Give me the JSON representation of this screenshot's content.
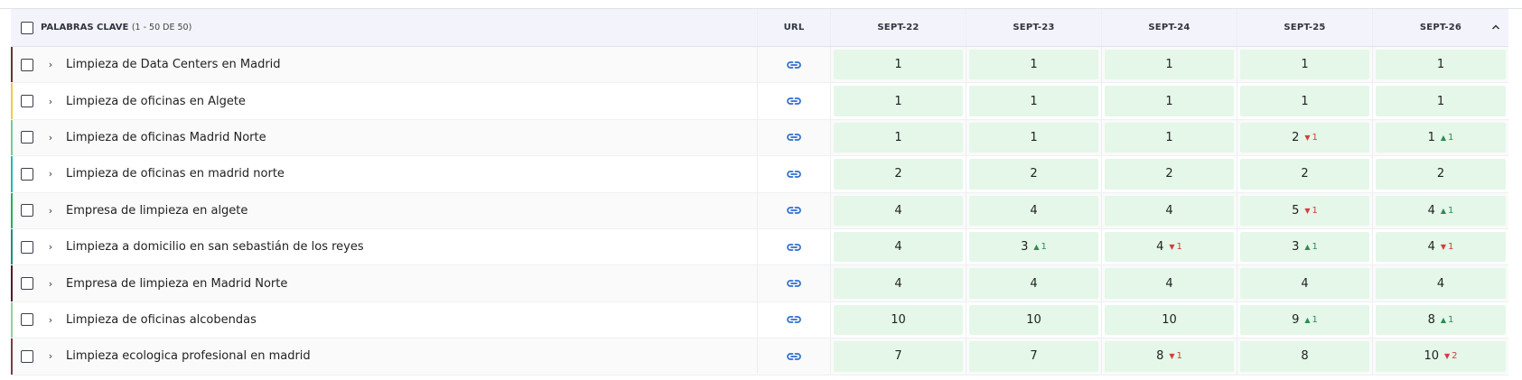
{
  "header": {
    "keywords_label": "PALABRAS CLAVE",
    "keywords_count": "(1 - 50 DE 50)",
    "url_label": "URL",
    "dates": [
      "SEPT-22",
      "SEPT-23",
      "SEPT-24",
      "SEPT-25",
      "SEPT-26"
    ]
  },
  "colors": {
    "cell_bg": "#e4f7e9",
    "up": "#2f8a52",
    "down": "#d63b3b",
    "link": "#2f6fd0"
  },
  "rows": [
    {
      "keyword": "Limpieza de Data Centers en Madrid",
      "stripe": "#5a3a2e",
      "ranks": [
        {
          "v": "1"
        },
        {
          "v": "1"
        },
        {
          "v": "1"
        },
        {
          "v": "1"
        },
        {
          "v": "1"
        }
      ]
    },
    {
      "keyword": "Limpieza de oficinas en Algete",
      "stripe": "#f2c94c",
      "ranks": [
        {
          "v": "1"
        },
        {
          "v": "1"
        },
        {
          "v": "1"
        },
        {
          "v": "1"
        },
        {
          "v": "1"
        }
      ]
    },
    {
      "keyword": "Limpieza de oficinas Madrid Norte",
      "stripe": "#6fcf97",
      "ranks": [
        {
          "v": "1"
        },
        {
          "v": "1"
        },
        {
          "v": "1"
        },
        {
          "v": "2",
          "d": "1",
          "dir": "down"
        },
        {
          "v": "1",
          "d": "1",
          "dir": "up"
        }
      ]
    },
    {
      "keyword": "Limpieza de oficinas en madrid norte",
      "stripe": "#2bb5a8",
      "ranks": [
        {
          "v": "2"
        },
        {
          "v": "2"
        },
        {
          "v": "2"
        },
        {
          "v": "2"
        },
        {
          "v": "2"
        }
      ]
    },
    {
      "keyword": "Empresa de limpieza en algete",
      "stripe": "#27ae60",
      "ranks": [
        {
          "v": "4"
        },
        {
          "v": "4"
        },
        {
          "v": "4"
        },
        {
          "v": "5",
          "d": "1",
          "dir": "down"
        },
        {
          "v": "4",
          "d": "1",
          "dir": "up"
        }
      ]
    },
    {
      "keyword": "Limpieza a domicilio en san sebastián de los reyes",
      "stripe": "#1f8f7a",
      "ranks": [
        {
          "v": "4"
        },
        {
          "v": "3",
          "d": "1",
          "dir": "up"
        },
        {
          "v": "4",
          "d": "1",
          "dir": "down"
        },
        {
          "v": "3",
          "d": "1",
          "dir": "up"
        },
        {
          "v": "4",
          "d": "1",
          "dir": "down"
        }
      ]
    },
    {
      "keyword": "Empresa de limpieza en Madrid Norte",
      "stripe": "#4a1f2a",
      "ranks": [
        {
          "v": "4"
        },
        {
          "v": "4"
        },
        {
          "v": "4"
        },
        {
          "v": "4"
        },
        {
          "v": "4"
        }
      ]
    },
    {
      "keyword": "Limpieza de oficinas alcobendas",
      "stripe": "#8fd19e",
      "ranks": [
        {
          "v": "10"
        },
        {
          "v": "10"
        },
        {
          "v": "10"
        },
        {
          "v": "9",
          "d": "1",
          "dir": "up"
        },
        {
          "v": "8",
          "d": "1",
          "dir": "up"
        }
      ]
    },
    {
      "keyword": "Limpieza ecologica profesional en madrid",
      "stripe": "#7a3b4a",
      "ranks": [
        {
          "v": "7"
        },
        {
          "v": "7"
        },
        {
          "v": "8",
          "d": "1",
          "dir": "down"
        },
        {
          "v": "8"
        },
        {
          "v": "10",
          "d": "2",
          "dir": "down"
        }
      ]
    }
  ]
}
